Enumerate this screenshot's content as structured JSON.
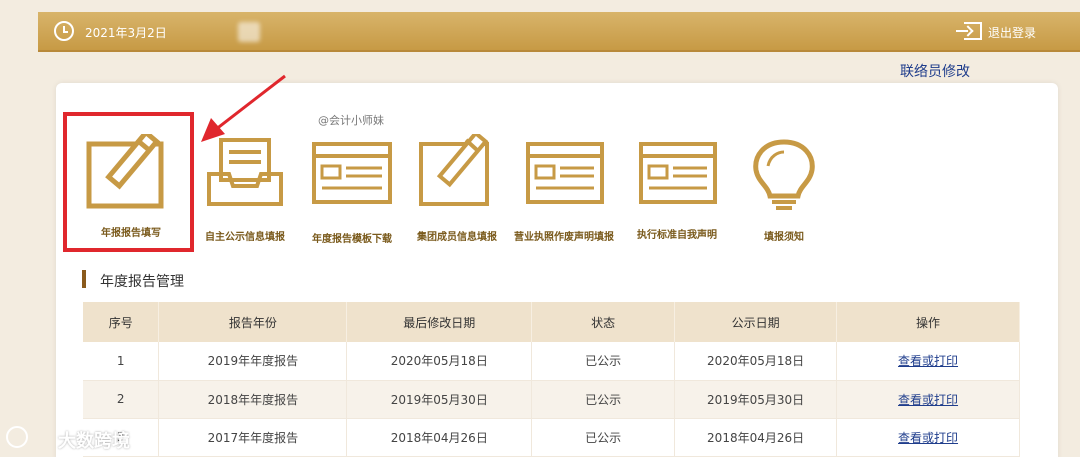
{
  "header": {
    "date": "2021年3月2日",
    "logout_label": "退出登录"
  },
  "contact_link": "联络员修改",
  "watermark": "@会计小师妹",
  "tiles": [
    {
      "label": "年报报告填写",
      "icon": "edit-pencil-icon"
    },
    {
      "label": "自主公示信息填报",
      "icon": "inbox-tray-icon"
    },
    {
      "label": "年度报告模板下载",
      "icon": "template-window-icon"
    },
    {
      "label": "集团成员信息填报",
      "icon": "edit-pencil-icon"
    },
    {
      "label": "营业执照作废声明填报",
      "icon": "template-window-icon"
    },
    {
      "label": "执行标准自我声明",
      "icon": "template-window-icon"
    },
    {
      "label": "填报须知",
      "icon": "lightbulb-icon"
    }
  ],
  "section_title": "年度报告管理",
  "table": {
    "headers": [
      "序号",
      "报告年份",
      "最后修改日期",
      "状态",
      "公示日期",
      "操作"
    ],
    "rows": [
      {
        "index": "1",
        "year": "2019年年度报告",
        "modified": "2020年05月18日",
        "status": "已公示",
        "published": "2020年05月18日",
        "action": "查看或打印"
      },
      {
        "index": "2",
        "year": "2018年年度报告",
        "modified": "2019年05月30日",
        "status": "已公示",
        "published": "2019年05月30日",
        "action": "查看或打印"
      },
      {
        "index": "3",
        "year": "2017年年度报告",
        "modified": "2018年04月26日",
        "status": "已公示",
        "published": "2018年04月26日",
        "action": "查看或打印"
      }
    ]
  },
  "brand": "大数跨境",
  "colors": {
    "accent_gold": "#c79a45",
    "highlight_red": "#e0272d",
    "link_blue": "#1f3d8c"
  }
}
